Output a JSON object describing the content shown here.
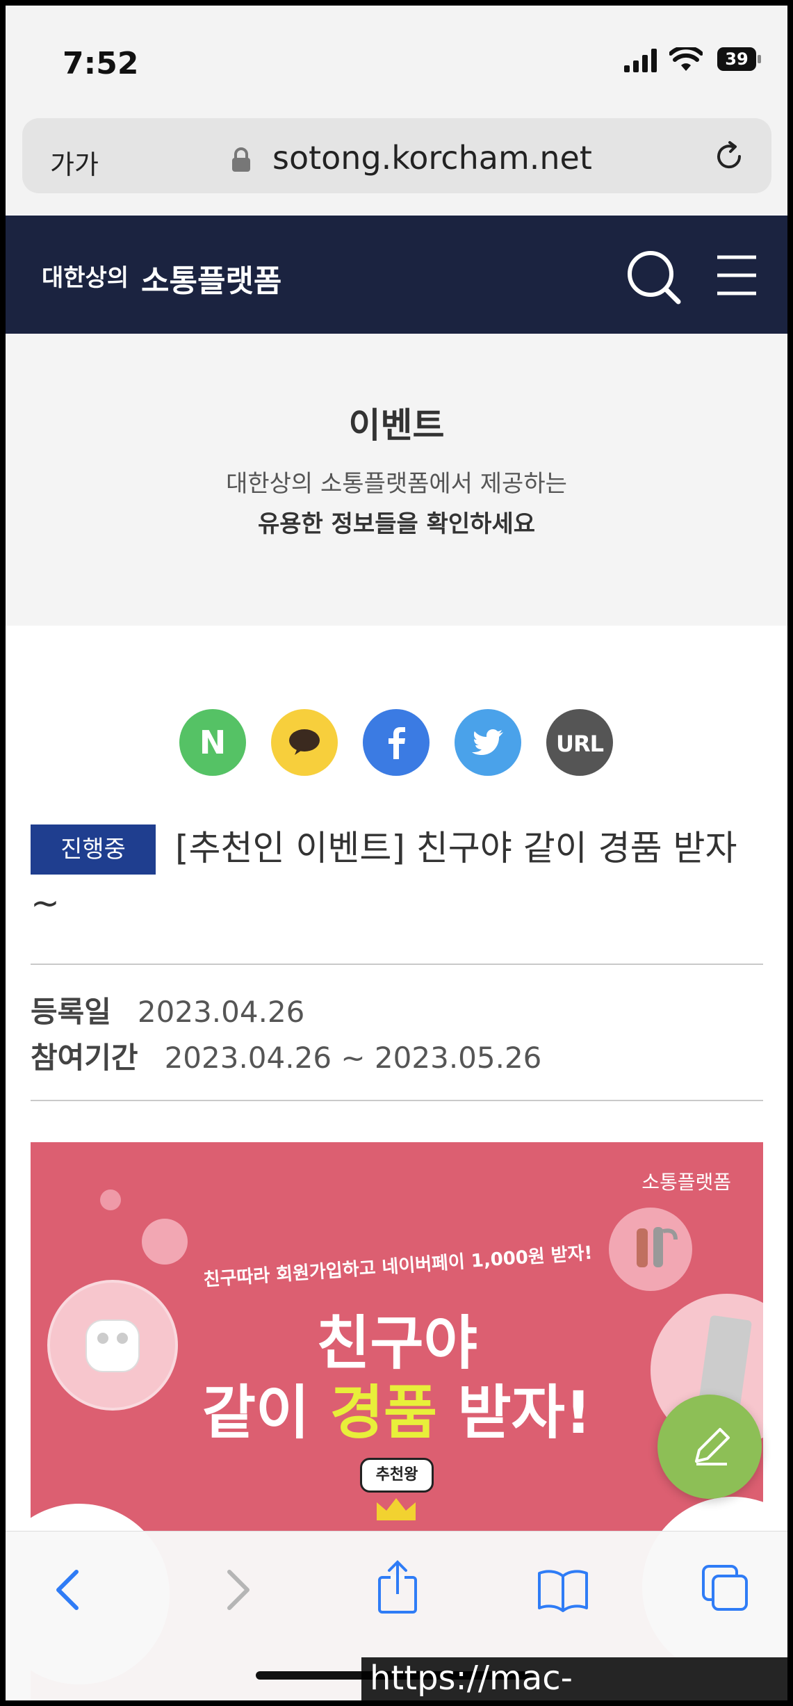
{
  "status_bar": {
    "time": "7:52",
    "battery": "39"
  },
  "browser": {
    "text_size_label": "가가",
    "url": "sotong.korcham.net"
  },
  "site_header": {
    "logo_prefix": "대한상의",
    "logo_main": "소통플랫폼"
  },
  "intro": {
    "title": "이벤트",
    "line1": "대한상의 소통플랫폼에서 제공하는",
    "line2": "유용한 정보들을 확인하세요"
  },
  "share": {
    "naver": "N",
    "url": "URL"
  },
  "event": {
    "status_badge": "진행중",
    "title": "[추천인 이벤트] 친구야 같이 경품 받자",
    "title_tail": "~",
    "reg_label": "등록일",
    "reg_date": "2023.04.26",
    "period_label": "참여기간",
    "period_value": "2023.04.26 ~ 2023.05.26"
  },
  "banner": {
    "brand": "소통플랫폼",
    "subtitle": "친구따라 회원가입하고 네이버페이 1,000원 받자!",
    "title_line1": "친구야",
    "title_line2_a": "같이 ",
    "title_line2_hl": "경품",
    "title_line2_b": " 받자!",
    "tag": "추천왕"
  },
  "watermark": "https://mac-os.tistory.com",
  "colors": {
    "header_bg": "#1b2340",
    "badge_bg": "#1f3e8f",
    "banner_bg": "#dc5f71",
    "fab_bg": "#8dbf56",
    "ios_blue": "#2f7cf6"
  }
}
